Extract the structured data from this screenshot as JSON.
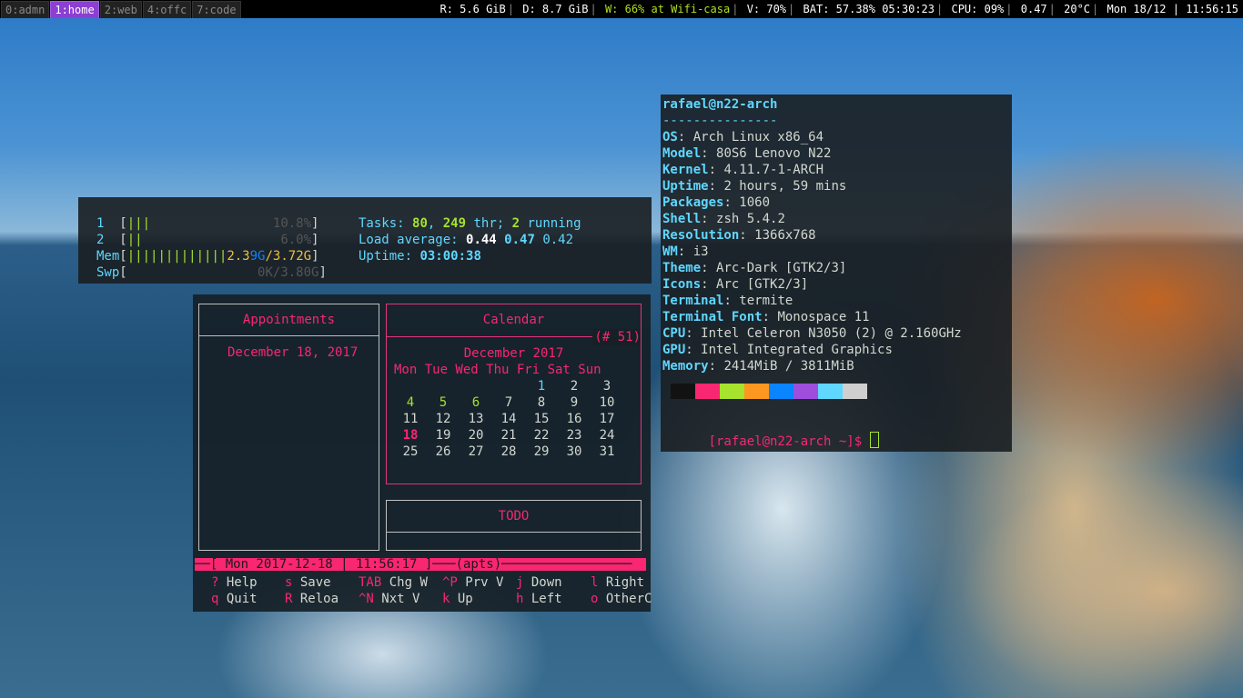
{
  "workspaces": [
    {
      "label": "0:admn",
      "active": false
    },
    {
      "label": "1:home",
      "active": true
    },
    {
      "label": "2:web",
      "active": false
    },
    {
      "label": "4:offc",
      "active": false
    },
    {
      "label": "7:code",
      "active": false
    }
  ],
  "status": {
    "ram": "R: 5.6 GiB",
    "disk": "D: 8.7 GiB",
    "wifi": "W:  66% at Wifi-casa",
    "volume": "V: 70%",
    "battery": "BAT: 57.38% 05:30:23",
    "cpu": "CPU: 09%",
    "load": "0.47",
    "temp": "20°C",
    "datetime": "Mon 18/12 | 11:56:15"
  },
  "htop": {
    "cpu1": {
      "num": "1",
      "bars": "|||",
      "value": "10.8%"
    },
    "cpu2": {
      "num": "2",
      "bars": "||",
      "value": "6.0%"
    },
    "mem": {
      "label": "Mem",
      "bars": "|||||||||||||",
      "used_a": "2.3",
      "used_b": "9G",
      "sep": "/",
      "total": "3.72G"
    },
    "swp": {
      "label": "Swp",
      "value": "0K/3.80G"
    },
    "tasks_label": "Tasks:",
    "tasks": "80",
    "threads": "249",
    "thr_label": "thr;",
    "running": "2",
    "running_label": "running",
    "load_label": "Load average:",
    "load1": "0.44",
    "load5": "0.47",
    "load15": "0.42",
    "uptime_label": "Uptime:",
    "uptime": "03:00:38"
  },
  "calcurse": {
    "appointments_title": "Appointments",
    "appointments_date": "December 18, 2017",
    "calendar_title": "Calendar",
    "week_number": "(# 51)",
    "month_label": "December 2017",
    "weekdays": "Mon Tue Wed Thu Fri Sat Sun",
    "weeks": [
      [
        "",
        "",
        "",
        "",
        "1",
        "2",
        "3"
      ],
      [
        "4",
        "5",
        "6",
        "7",
        "8",
        "9",
        "10"
      ],
      [
        "11",
        "12",
        "13",
        "14",
        "15",
        "16",
        "17"
      ],
      [
        "18",
        "19",
        "20",
        "21",
        "22",
        "23",
        "24"
      ],
      [
        "25",
        "26",
        "27",
        "28",
        "29",
        "30",
        "31"
      ]
    ],
    "todo_title": "TODO",
    "statusline": "──[ Mon 2017-12-18 | 11:56:17 ]───(apts)─────────────────",
    "keys_row1": [
      {
        "key": "?",
        "label": "Help"
      },
      {
        "key": "s",
        "label": "Save"
      },
      {
        "key": "TAB",
        "label": "Chg W"
      },
      {
        "key": "^P",
        "label": "Prv V"
      },
      {
        "key": "j",
        "label": "Down"
      },
      {
        "key": "l",
        "label": "Right"
      }
    ],
    "keys_row2": [
      {
        "key": "q",
        "label": "Quit"
      },
      {
        "key": "R",
        "label": "Reloa"
      },
      {
        "key": "^N",
        "label": "Nxt V"
      },
      {
        "key": "k",
        "label": "Up"
      },
      {
        "key": "h",
        "label": "Left"
      },
      {
        "key": "o",
        "label": "OtherC"
      }
    ]
  },
  "neofetch": {
    "user_host": "rafael@n22-arch",
    "divider": "---------------",
    "fields": [
      {
        "key": "OS",
        "value": "Arch Linux x86_64"
      },
      {
        "key": "Model",
        "value": "80S6 Lenovo N22"
      },
      {
        "key": "Kernel",
        "value": "4.11.7-1-ARCH"
      },
      {
        "key": "Uptime",
        "value": "2 hours, 59 mins"
      },
      {
        "key": "Packages",
        "value": "1060"
      },
      {
        "key": "Shell",
        "value": "zsh 5.4.2"
      },
      {
        "key": "Resolution",
        "value": "1366x768"
      },
      {
        "key": "WM",
        "value": "i3"
      },
      {
        "key": "Theme",
        "value": "Arc-Dark [GTK2/3]"
      },
      {
        "key": "Icons",
        "value": "Arc [GTK2/3]"
      },
      {
        "key": "Terminal",
        "value": "termite"
      },
      {
        "key": "Terminal Font",
        "value": "Monospace 11"
      },
      {
        "key": "CPU",
        "value": "Intel Celeron N3050 (2) @ 2.160GHz"
      },
      {
        "key": "GPU",
        "value": "Intel Integrated Graphics"
      },
      {
        "key": "Memory",
        "value": "2414MiB / 3811MiB"
      }
    ],
    "colors": [
      "#121212",
      "#f92672",
      "#a6e22e",
      "#fd971f",
      "#0a84ff",
      "#9d4edd",
      "#5fd7ff",
      "#cfcfcf"
    ],
    "prompt": "[rafael@n22-arch ~]$ "
  }
}
